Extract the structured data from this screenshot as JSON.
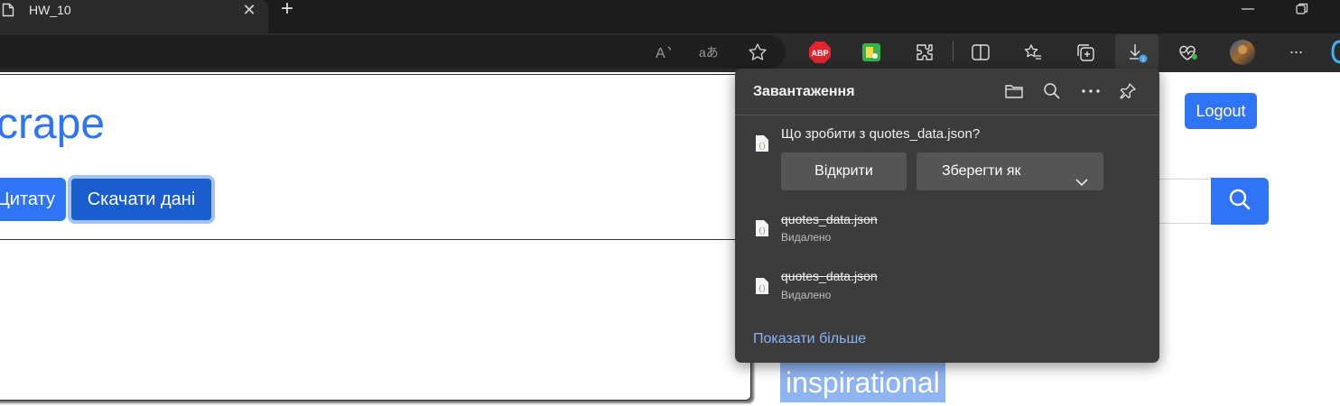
{
  "tab": {
    "title": "HW_10",
    "close_glyph": "✕",
    "new_tab_glyph": "+"
  },
  "toolbar": {
    "icons": [
      "read-aloud-icon",
      "translate-icon",
      "favorite-star-icon",
      "adblock-plus-icon",
      "extension-green-icon",
      "extensions-icon",
      "split-screen-icon",
      "favorites-icon",
      "collections-icon",
      "downloads-icon",
      "browser-essentials-icon",
      "profile-avatar",
      "more-icon"
    ],
    "adblock_label": "ABP",
    "more_glyph": "···"
  },
  "page": {
    "title": "crape",
    "quote_button": "Цитату",
    "download_button": "Скачати дані",
    "logout_button": "Logout",
    "tag": "inspirational"
  },
  "downloads": {
    "title": "Завантаження",
    "prompt": "Що зробити з quotes_data.json?",
    "open_button": "Відкрити",
    "save_as_button": "Зберегти як",
    "items": [
      {
        "name": "quotes_data.json",
        "status": "Видалено"
      },
      {
        "name": "quotes_data.json",
        "status": "Видалено"
      }
    ],
    "show_more": "Показати більше"
  },
  "colors": {
    "accent": "#2f74f5",
    "link": "#8ab4f8",
    "flyout_bg": "#3c3c3c",
    "toolbar_bg": "#2b2b2b"
  }
}
